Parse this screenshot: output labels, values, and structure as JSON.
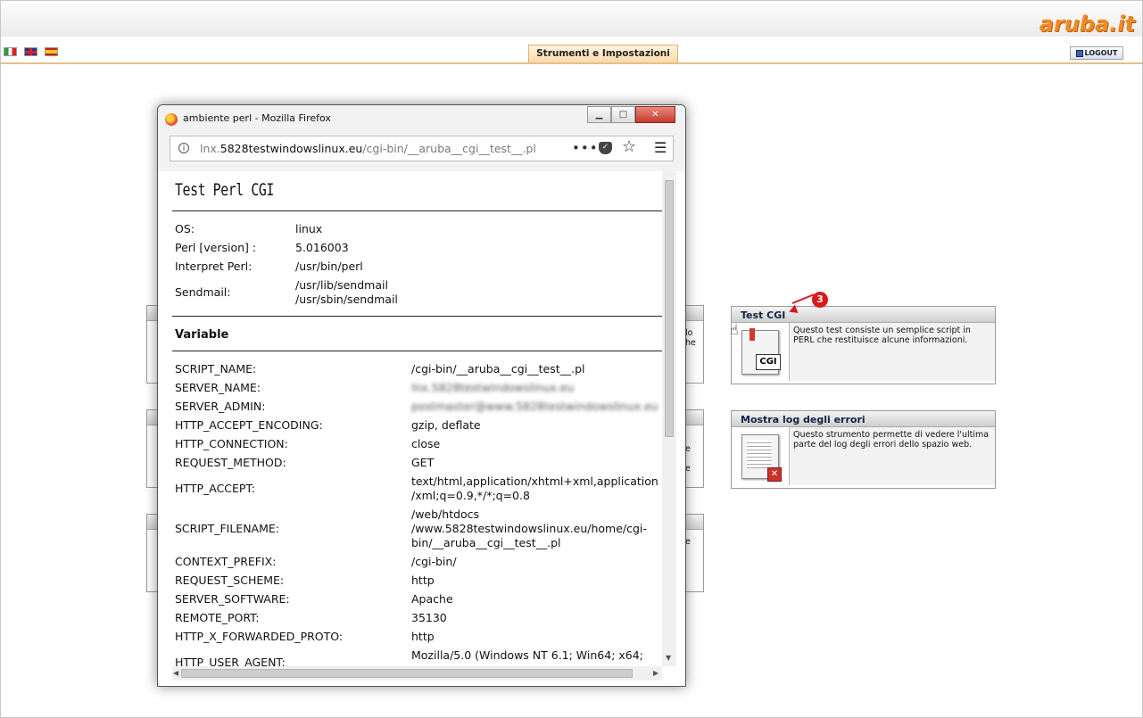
{
  "header": {
    "logo_text": "aruba.it",
    "active_tab": "Strumenti e Impostazioni",
    "logout_label": "LOGOUT"
  },
  "flags": [
    "flag-italy-icon",
    "flag-uk-icon",
    "flag-spain-icon"
  ],
  "background_fragments": {
    "box1": [
      "lo",
      "he"
    ],
    "box2": [
      "e",
      "e"
    ],
    "box3": [
      "e"
    ]
  },
  "tools": {
    "test_cgi": {
      "title": "Test CGI",
      "description": "Questo test consiste un semplice script in PERL che restituisce alcune informazioni.",
      "icon_label": "CGI"
    },
    "error_log": {
      "title": "Mostra log degli errori",
      "description": "Questo strumento permette di vedere l'ultima parte del log degli errori dello spazio web."
    },
    "annotation_badge": "3"
  },
  "browser": {
    "window_title": "ambiente perl - Mozilla Firefox",
    "url_prefix": "lnx.",
    "url_domain": "5828testwindowslinux.eu",
    "url_path": "/cgi-bin/__aruba__cgi__test__.pl",
    "page_title": "Test Perl CGI",
    "info": [
      {
        "key": "OS:",
        "value": "linux"
      },
      {
        "key": "Perl [version] :",
        "value": "5.016003"
      },
      {
        "key": "Interpret Perl:",
        "value": "/usr/bin/perl"
      },
      {
        "key": "Sendmail:",
        "value": "/usr/lib/sendmail",
        "value2": "/usr/sbin/sendmail"
      }
    ],
    "variables_heading": "Variable",
    "variables": [
      {
        "key": "SCRIPT_NAME:",
        "value": "/cgi-bin/__aruba__cgi__test__.pl"
      },
      {
        "key": "SERVER_NAME:",
        "value": "lnx.5828testwindowslinux.eu"
      },
      {
        "key": "SERVER_ADMIN:",
        "value": "postmaster@www.5828testwindowslinux.eu"
      },
      {
        "key": "HTTP_ACCEPT_ENCODING:",
        "value": "gzip, deflate"
      },
      {
        "key": "HTTP_CONNECTION:",
        "value": "close"
      },
      {
        "key": "REQUEST_METHOD:",
        "value": "GET"
      },
      {
        "key": "HTTP_ACCEPT:",
        "value": "text/html,application/xhtml+xml,application",
        "value2": "/xml;q=0.9,*/*;q=0.8"
      },
      {
        "key": "SCRIPT_FILENAME:",
        "value": "/web/htdocs",
        "value2": "/www.5828testwindowslinux.eu/home/cgi-",
        "value3": "bin/__aruba__cgi__test__.pl"
      },
      {
        "key": "CONTEXT_PREFIX:",
        "value": "/cgi-bin/"
      },
      {
        "key": "REQUEST_SCHEME:",
        "value": "http"
      },
      {
        "key": "SERVER_SOFTWARE:",
        "value": "Apache"
      },
      {
        "key": "REMOTE_PORT:",
        "value": "35130"
      },
      {
        "key": "HTTP_X_FORWARDED_PROTO:",
        "value": "http"
      },
      {
        "key": "HTTP_USER_AGENT:",
        "value": "Mozilla/5.0 (Windows NT 6.1; Win64; x64;"
      }
    ]
  }
}
